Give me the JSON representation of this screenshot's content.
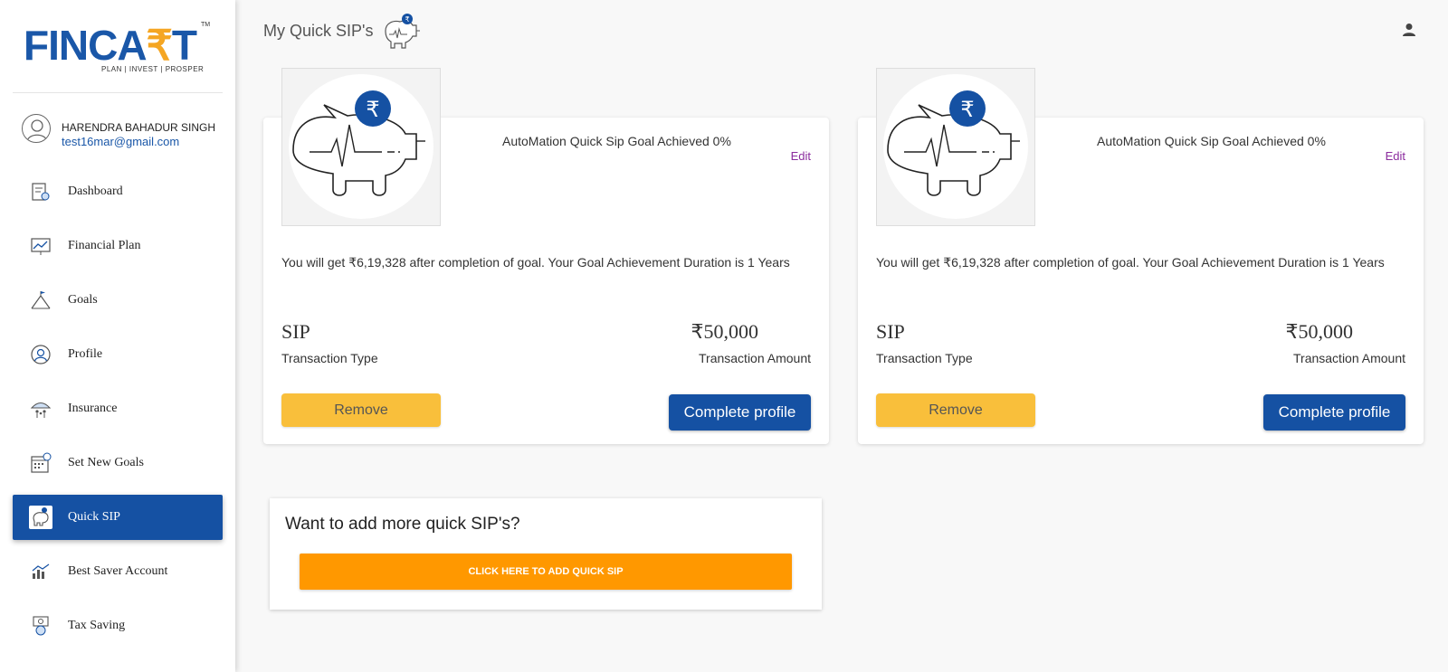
{
  "brand": {
    "word_left": "FINCA",
    "word_accent": "₹",
    "word_right": "T",
    "tm": "TM",
    "tagline": "PLAN | INVEST | PROSPER"
  },
  "user": {
    "name": "HARENDRA BAHADUR SINGH",
    "email": "test16mar@gmail.com"
  },
  "nav": [
    {
      "label": "Dashboard",
      "icon": "dashboard-icon"
    },
    {
      "label": "Financial Plan",
      "icon": "chart-icon"
    },
    {
      "label": "Goals",
      "icon": "mountain-flag-icon"
    },
    {
      "label": "Profile",
      "icon": "user-circle-icon"
    },
    {
      "label": "Insurance",
      "icon": "umbrella-family-icon"
    },
    {
      "label": "Set New Goals",
      "icon": "calendar-target-icon"
    },
    {
      "label": "Quick SIP",
      "icon": "piggy-bank-icon",
      "active": true
    },
    {
      "label": "Best Saver Account",
      "icon": "savings-chart-icon"
    },
    {
      "label": "Tax Saving",
      "icon": "tax-money-icon"
    }
  ],
  "header": {
    "title": "My Quick SIP's"
  },
  "cards": [
    {
      "title": "AutoMation Quick Sip Goal Achieved 0%",
      "edit": "Edit",
      "description": "You will get ₹6,19,328 after completion of goal. Your Goal Achievement Duration is 1 Years",
      "type_value": "SIP",
      "type_label": "Transaction Type",
      "amount_value": "₹50,000",
      "amount_label": "Transaction Amount",
      "remove_label": "Remove",
      "complete_label": "Complete profile"
    },
    {
      "title": "AutoMation Quick Sip Goal Achieved 0%",
      "edit": "Edit",
      "description": "You will get ₹6,19,328 after completion of goal. Your Goal Achievement Duration is 1 Years",
      "type_value": "SIP",
      "type_label": "Transaction Type",
      "amount_value": "₹50,000",
      "amount_label": "Transaction Amount",
      "remove_label": "Remove",
      "complete_label": "Complete profile"
    }
  ],
  "add_more": {
    "title": "Want to add more quick SIP's?",
    "button": "CLICK HERE TO ADD QUICK SIP"
  },
  "colors": {
    "primary": "#1551a3",
    "accent_yellow": "#f9bf3b",
    "accent_orange": "#ff9800",
    "edit_purple": "#8b2c9e",
    "rupee": "#f5a623"
  }
}
